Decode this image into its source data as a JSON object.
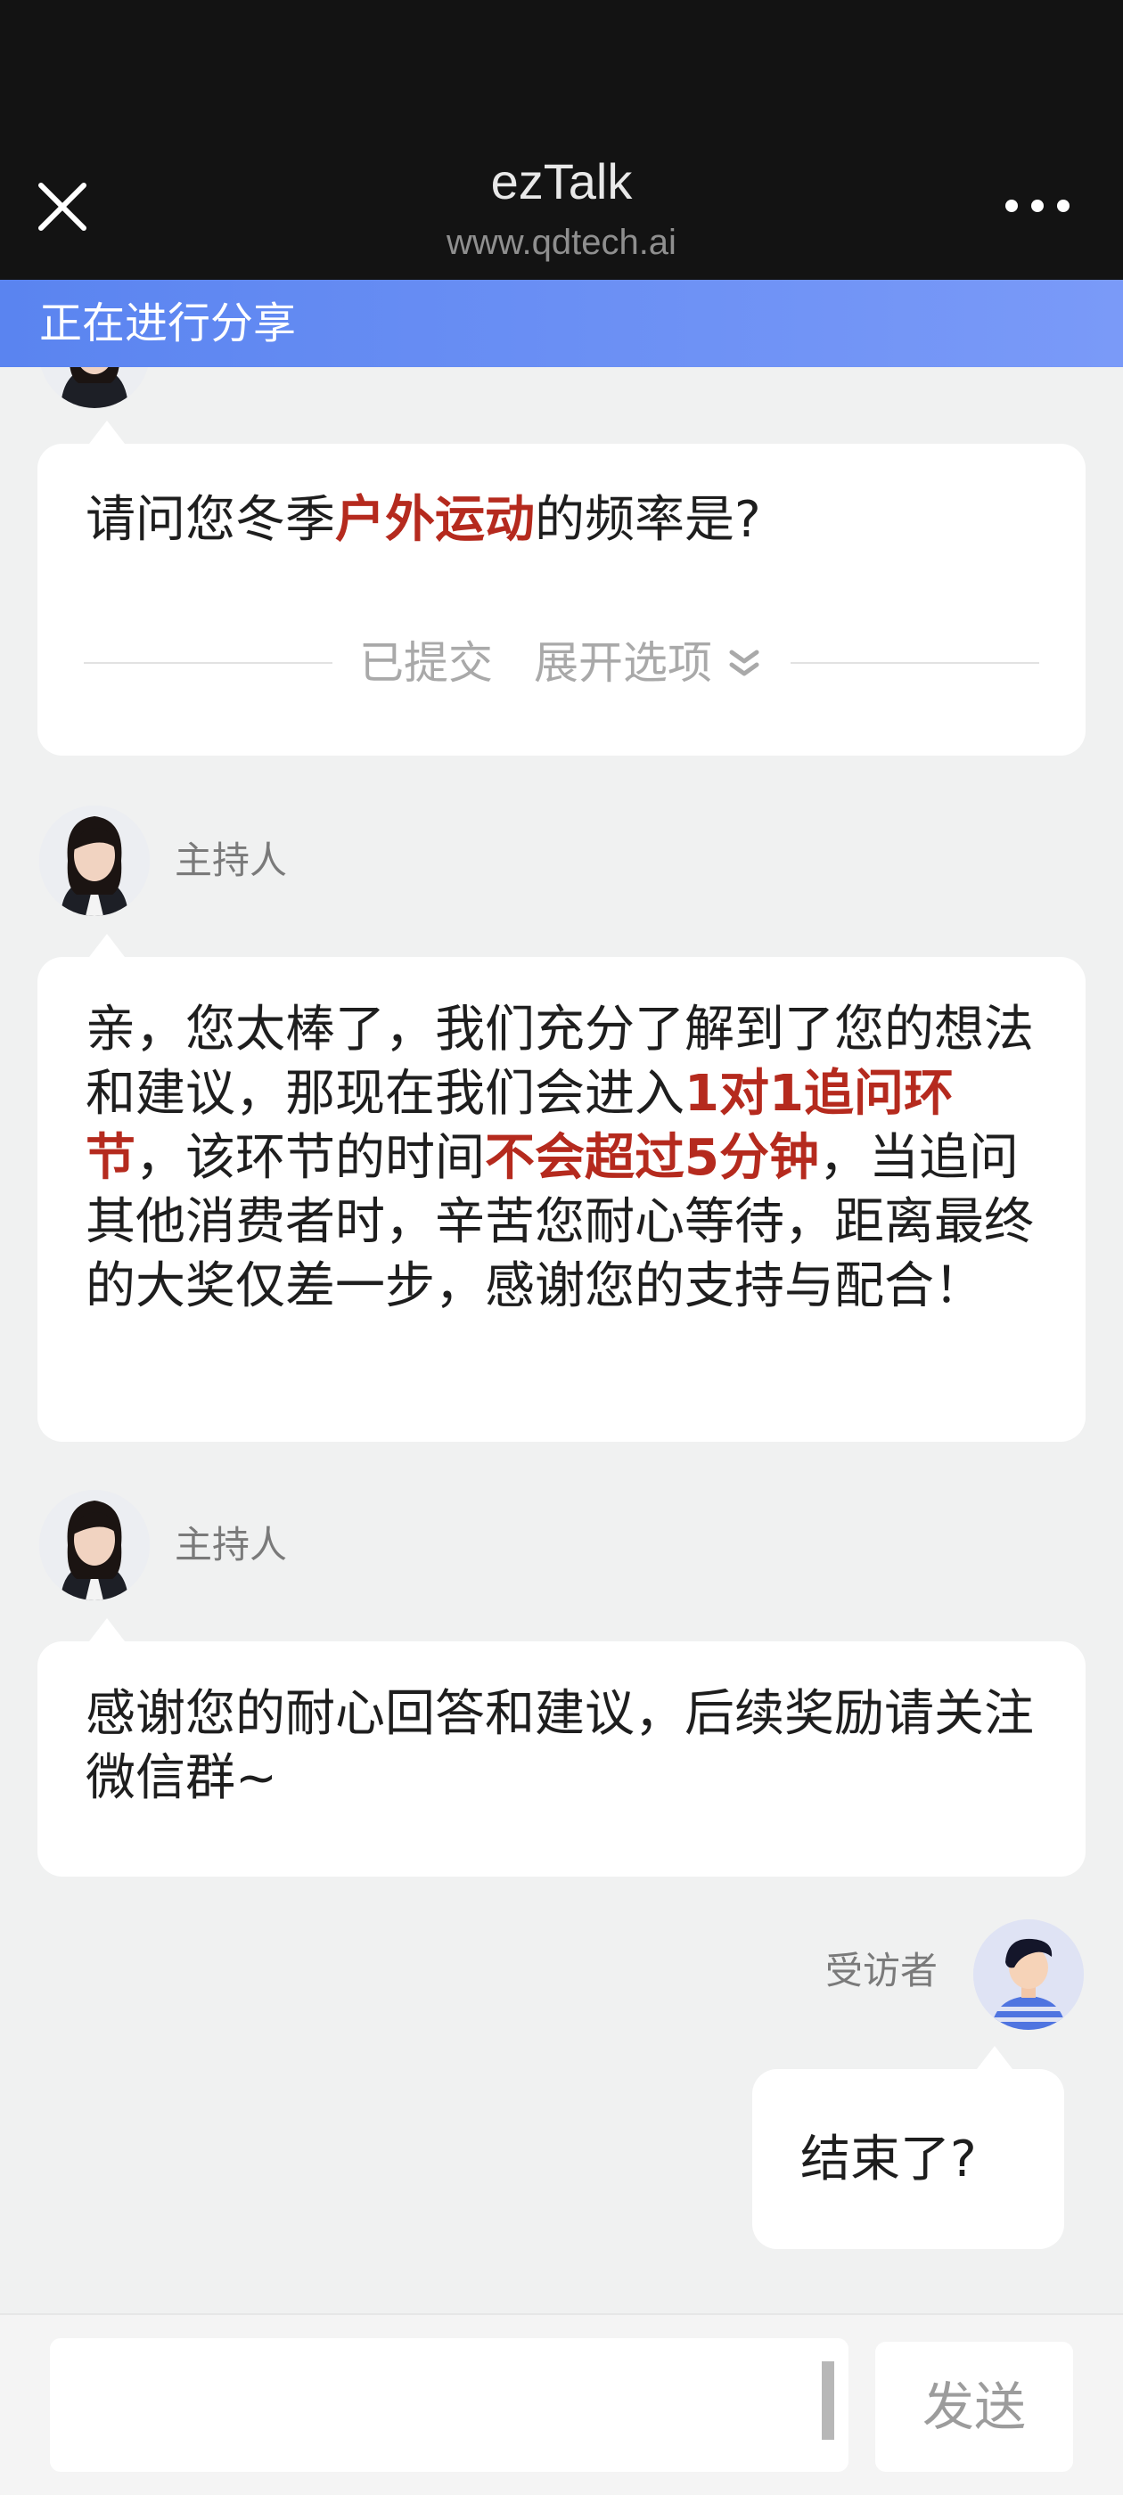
{
  "header": {
    "title": "ezTalk",
    "subtitle": "www.qdtech.ai",
    "close_icon": "close-icon",
    "more_icon": "more-dots-icon"
  },
  "share_banner": {
    "text": "正在进行分享"
  },
  "messages": {
    "question": {
      "prefix": "请问您冬季",
      "highlight": "户外运动",
      "suffix": "的频率是?",
      "submitted_label": "已提交",
      "expand_label": "展开选项"
    },
    "host_1": {
      "speaker": "主持人",
      "part1": "亲，您太棒了，我们充分了解到了您的想法和建议，那现在我们会进入",
      "hl1": "1对1追问环节",
      "part2": "，该环节的时间",
      "hl2": "不会超过5分钟",
      "part3": "，当追问其他消费者时，辛苦您耐心等待，距离最终的大奖仅差一步，感谢您的支持与配合！"
    },
    "host_2": {
      "speaker": "主持人",
      "text": "感谢您的耐心回答和建议，后续奖励请关注微信群~"
    },
    "guest_1": {
      "speaker": "受访者",
      "text": "结束了?"
    }
  },
  "input": {
    "placeholder": "",
    "send_label": "发送"
  },
  "colors": {
    "highlight": "#b52a1e",
    "banner_start": "#5a84f0",
    "banner_end": "#7a9af8",
    "header_bg": "#131313"
  }
}
